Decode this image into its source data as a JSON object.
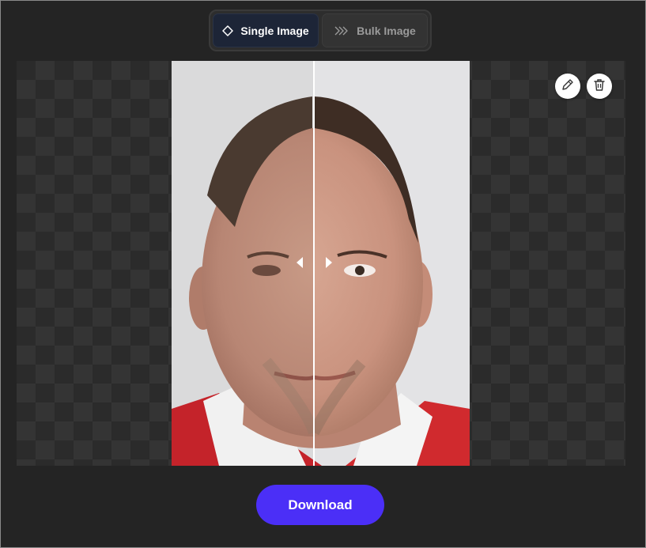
{
  "tabs": {
    "single_label": "Single Image",
    "single_icon": "diamond-icon",
    "bulk_label": "Bulk Image",
    "bulk_icon": "layers-chevron-icon",
    "active": "single"
  },
  "preview": {
    "description_icon_edit": "pencil-icon",
    "description_icon_delete": "trash-icon",
    "comparison_slider_position": 0.48
  },
  "actions": {
    "download_label": "Download"
  },
  "colors": {
    "background": "#242424",
    "accent": "#4b2ff7",
    "tab_active": "#1d2537"
  }
}
